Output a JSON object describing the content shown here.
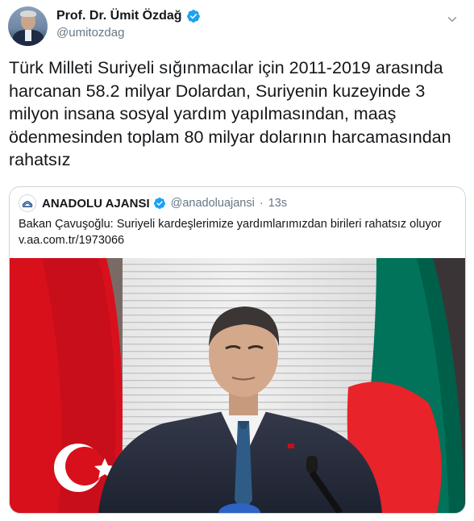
{
  "tweet": {
    "author": {
      "display_name": "Prof. Dr. Ümit Özdağ",
      "handle": "@umitozdag",
      "verified": true
    },
    "text": "Türk Milleti Suriyeli sığınmacılar için 2011-2019 arasında harcanan 58.2 milyar Dolardan, Suriyenin kuzeyinde 3 milyon insana sosyal yardım yapılmasından, maaş ödenmesinden toplam 80 milyar dolarının harcamasından rahatsız",
    "quoted_tweet": {
      "author": {
        "display_name": "ANADOLU AJANSI",
        "handle": "@anadoluajansi",
        "verified": true
      },
      "time": "13s",
      "separator": "·",
      "text": "Bakan Çavuşoğlu: Suriyeli kardeşlerimize yardımlarımızdan birileri rahatsız oluyor",
      "link": "v.aa.com.tr/1973066",
      "photo_description_icon": "photo-icon"
    }
  },
  "colors": {
    "verified_blue": "#1da1f2",
    "text_primary": "#14171a",
    "text_secondary": "#657786",
    "border": "#ccd6dd",
    "flag_red": "#e30a17",
    "flag_green": "#006a4e"
  },
  "icons": {
    "menu": "chevron-down-icon",
    "verified": "verified-badge-icon"
  }
}
